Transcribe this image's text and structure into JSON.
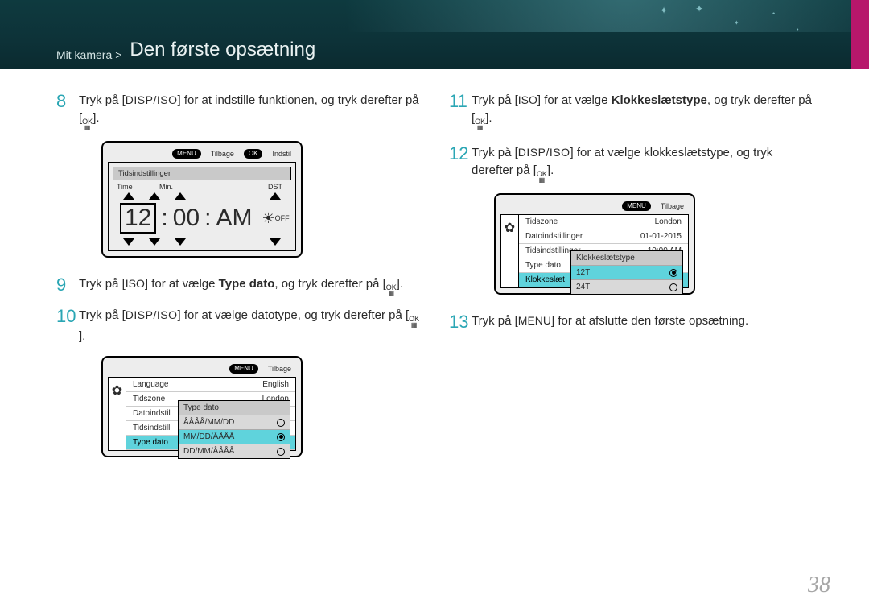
{
  "header": {
    "breadcrumb_root": "Mit kamera",
    "breadcrumb_title": "Den første opsætning"
  },
  "page_number": "38",
  "buttons": {
    "disp_iso": "DISP/ISO",
    "iso": "ISO",
    "menu": "MENU",
    "ok_top": "OK",
    "ok_bot": "▦"
  },
  "steps": {
    "s8": {
      "num": "8",
      "pre": "Tryk på [",
      "mid1": "] for at indstille funktionen, og tryk derefter på [",
      "end": "]."
    },
    "s9": {
      "num": "9",
      "pre": "Tryk på [",
      "mid1": "] for at vælge ",
      "bold": "Type dato",
      "mid2": ", og tryk derefter på [",
      "end": "]."
    },
    "s10": {
      "num": "10",
      "pre": "Tryk på [",
      "mid1": "] for at vælge datotype, og tryk derefter på [",
      "end": "]."
    },
    "s11": {
      "num": "11",
      "pre": "Tryk på [",
      "mid1": "] for at vælge ",
      "bold": "Klokkeslætstype",
      "mid2": ", og tryk derefter på [",
      "end": "]."
    },
    "s12": {
      "num": "12",
      "pre": "Tryk på [",
      "mid1": "] for at vælge klokkeslætstype, og tryk derefter på [",
      "end": "]."
    },
    "s13": {
      "num": "13",
      "pre": "Tryk på [",
      "mid1": "] for at afslutte den første opsætning."
    }
  },
  "shot_time": {
    "menu_label": "Tilbage",
    "ok_label": "Indstil",
    "title": "Tidsindstillinger",
    "col_time": "Time",
    "col_min": "Min.",
    "col_dst": "DST",
    "value_hour": "12",
    "value_min": "00",
    "value_ampm": "AM",
    "dst_suffix": "OFF"
  },
  "shot_typedato": {
    "menu_label": "Tilbage",
    "rows": {
      "language_l": "Language",
      "language_v": "English",
      "tidszone_l": "Tidszone",
      "tidszone_v": "London",
      "dato_l": "Datoindstil",
      "tids_l": "Tidsindstill",
      "typedato_l": "Type dato"
    },
    "popup_title": "Type dato",
    "popup_options": [
      "ÅÅÅÅ/MM/DD",
      "MM/DD/ÅÅÅÅ",
      "DD/MM/ÅÅÅÅ"
    ],
    "popup_selected_index": 1
  },
  "shot_klokke": {
    "menu_label": "Tilbage",
    "rows": {
      "tidszone_l": "Tidszone",
      "tidszone_v": "London",
      "dato_l": "Datoindstillinger",
      "dato_v": "01-01-2015",
      "tids_l": "Tidsindstillinger",
      "tids_v": "10:00 AM",
      "typedato_l": "Type dato",
      "klokke_l": "Klokkeslæt"
    },
    "popup_title": "Klokkeslætstype",
    "popup_options": [
      "12T",
      "24T"
    ],
    "popup_selected_index": 0
  }
}
